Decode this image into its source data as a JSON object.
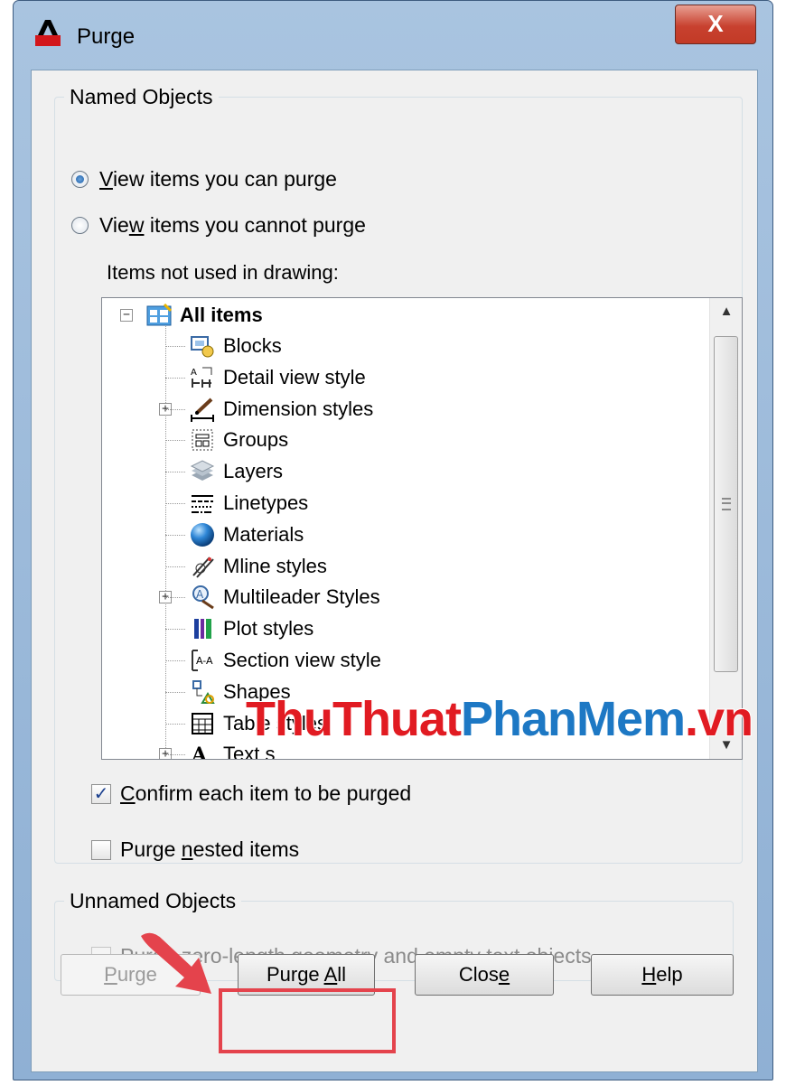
{
  "window": {
    "title": "Purge",
    "close_glyph": "X"
  },
  "named_objects": {
    "legend": "Named Objects",
    "radio_can": {
      "pre": "",
      "key": "V",
      "post": "iew items you can purge",
      "selected": true
    },
    "radio_cannot": {
      "pre": "Vie",
      "key": "w",
      "post": " items you cannot purge",
      "selected": false
    },
    "items_label": "Items not used in drawing:",
    "tree": {
      "root": {
        "label": "All items",
        "icon": "all-items-icon",
        "expanded": true
      },
      "items": [
        {
          "label": "Blocks",
          "icon": "block-icon",
          "expandable": false
        },
        {
          "label": "Detail view style",
          "icon": "detail-view-style-icon",
          "expandable": false
        },
        {
          "label": "Dimension styles",
          "icon": "dimension-style-icon",
          "expandable": true
        },
        {
          "label": "Groups",
          "icon": "group-icon",
          "expandable": false
        },
        {
          "label": "Layers",
          "icon": "layers-icon",
          "expandable": false
        },
        {
          "label": "Linetypes",
          "icon": "linetype-icon",
          "expandable": false
        },
        {
          "label": "Materials",
          "icon": "material-sphere-icon",
          "expandable": false
        },
        {
          "label": "Mline styles",
          "icon": "mline-style-icon",
          "expandable": false
        },
        {
          "label": "Multileader Styles",
          "icon": "multileader-style-icon",
          "expandable": true
        },
        {
          "label": "Plot styles",
          "icon": "plot-style-icon",
          "expandable": false
        },
        {
          "label": "Section view style",
          "icon": "section-view-style-icon",
          "expandable": false
        },
        {
          "label": "Shapes",
          "icon": "shape-icon",
          "expandable": false
        },
        {
          "label": "Table styles",
          "icon": "table-style-icon",
          "expandable": false
        },
        {
          "label": "Text s",
          "icon": "text-style-icon",
          "expandable": true
        }
      ]
    },
    "confirm": {
      "pre": "",
      "key": "C",
      "post": "onfirm each item to be purged",
      "checked": true,
      "check_glyph": "✓"
    },
    "nested": {
      "pre": "Purge ",
      "key": "n",
      "post": "ested items",
      "checked": false
    }
  },
  "unnamed_objects": {
    "legend": "Unnamed Objects",
    "zero_length": {
      "pre": "Purge ",
      "key": "z",
      "post": "ero-length geometry and empty text objects",
      "checked": false,
      "enabled": false
    }
  },
  "buttons": {
    "purge": {
      "pre": "",
      "key": "P",
      "post": "urge",
      "enabled": false
    },
    "purge_all": {
      "pre": "Purge ",
      "key": "A",
      "post": "ll",
      "enabled": true
    },
    "close": {
      "pre": "Clos",
      "key": "e",
      "post": "",
      "enabled": true
    },
    "help": {
      "pre": "",
      "key": "H",
      "post": "elp",
      "enabled": true
    }
  },
  "watermark": {
    "part1": "ThuThuat",
    "part2": "PhanMem",
    "part3": ".vn"
  },
  "colors": {
    "highlight": "#e4434c",
    "watermark_red": "#e11b22",
    "watermark_blue": "#1d78c4",
    "title_gradient": "#a9c4e0"
  }
}
